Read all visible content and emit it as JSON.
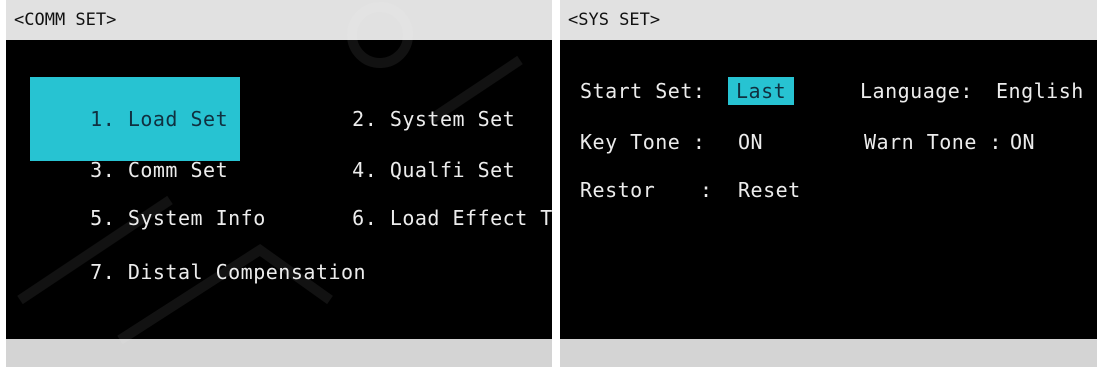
{
  "comm_set": {
    "title": "<COMM SET>",
    "menu": [
      {
        "number": "1.",
        "label": "Load Set",
        "selected": true
      },
      {
        "number": "2.",
        "label": "System Set"
      },
      {
        "number": "3.",
        "label": "Comm Set"
      },
      {
        "number": "4.",
        "label": "Qualfi Set"
      },
      {
        "number": "5.",
        "label": "System Info"
      },
      {
        "number": "6.",
        "label": "Load Effect Test"
      },
      {
        "number": "7.",
        "label": "Distal Compensation"
      }
    ]
  },
  "sys_set": {
    "title": "<SYS SET>",
    "start_set": {
      "label": "Start Set:",
      "value": "Last"
    },
    "language": {
      "label": "Language:",
      "value": "English"
    },
    "key_tone": {
      "label": "Key Tone :",
      "value": "ON"
    },
    "warn_tone": {
      "label": "Warn Tone :",
      "value": "ON"
    },
    "restor": {
      "label": "Restor",
      "colon": ":",
      "value": "Reset"
    }
  },
  "colors": {
    "highlight": "#27c3d2",
    "screen_bg": "#000000",
    "title_bg": "#e1e1e1",
    "text": "#ececec"
  }
}
